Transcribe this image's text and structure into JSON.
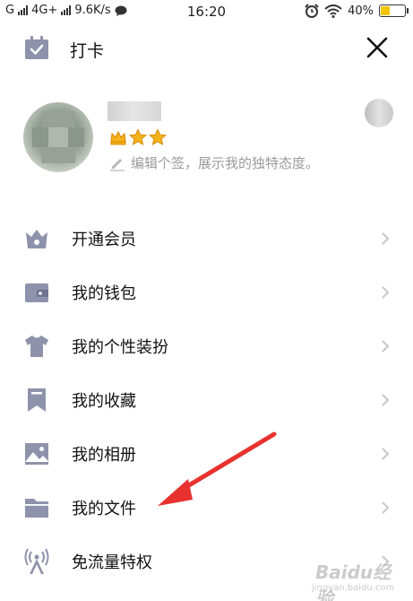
{
  "status_bar": {
    "carrier_left": "G",
    "network": "4G+",
    "speed": "9.6K/s",
    "time": "16:20",
    "battery": "40%",
    "battery_level": 0.4
  },
  "header": {
    "checkin_label": "打卡"
  },
  "profile": {
    "signature_hint": "编辑个签，展示我的独特态度。",
    "badge_count": 3
  },
  "menu": {
    "items": [
      {
        "label": "开通会员",
        "icon": "crown-vip-icon"
      },
      {
        "label": "我的钱包",
        "icon": "wallet-icon"
      },
      {
        "label": "我的个性装扮",
        "icon": "tshirt-icon"
      },
      {
        "label": "我的收藏",
        "icon": "bookmark-icon"
      },
      {
        "label": "我的相册",
        "icon": "picture-icon"
      },
      {
        "label": "我的文件",
        "icon": "folder-icon"
      },
      {
        "label": "免流量特权",
        "icon": "antenna-icon"
      }
    ]
  },
  "watermark": {
    "text": "Baidu经验",
    "sub": "jingyan.baidu.com"
  },
  "colors": {
    "icon_gray": "#8e93ab",
    "chevron": "#c7c7c7",
    "annotation_red": "#e8322f",
    "hint_gray": "#9b9b9b",
    "star_gold": "#f6b21a"
  }
}
